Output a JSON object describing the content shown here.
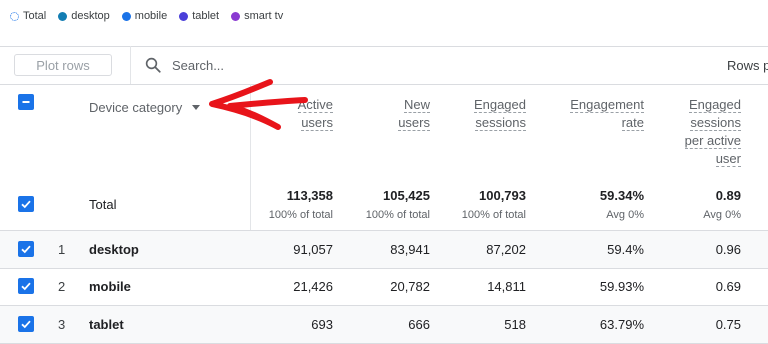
{
  "legend": [
    {
      "label": "Total",
      "color": "#1a73e8",
      "style": "dotted"
    },
    {
      "label": "desktop",
      "color": "#137db3"
    },
    {
      "label": "mobile",
      "color": "#1a73e8"
    },
    {
      "label": "tablet",
      "color": "#4a3fd9"
    },
    {
      "label": "smart tv",
      "color": "#8a3ad1"
    }
  ],
  "toolbar": {
    "plot_rows_label": "Plot rows",
    "search_placeholder": "Search...",
    "rows_label": "Rows p"
  },
  "table": {
    "dimension_header": "Device category",
    "columns": [
      {
        "lines": [
          "Active",
          "users"
        ]
      },
      {
        "lines": [
          "New",
          "users"
        ]
      },
      {
        "lines": [
          "Engaged",
          "sessions"
        ]
      },
      {
        "lines": [
          "Engagement",
          "rate"
        ]
      },
      {
        "lines": [
          "Engaged",
          "sessions",
          "per active",
          "user"
        ]
      }
    ],
    "total": {
      "label": "Total",
      "values": [
        "113,358",
        "105,425",
        "100,793",
        "59.34%",
        "0.89"
      ],
      "subs": [
        "100% of total",
        "100% of total",
        "100% of total",
        "Avg 0%",
        "Avg 0%"
      ]
    },
    "rows": [
      {
        "rank": "1",
        "name": "desktop",
        "values": [
          "91,057",
          "83,941",
          "87,202",
          "59.4%",
          "0.96"
        ]
      },
      {
        "rank": "2",
        "name": "mobile",
        "values": [
          "21,426",
          "20,782",
          "14,811",
          "59.93%",
          "0.69"
        ]
      },
      {
        "rank": "3",
        "name": "tablet",
        "values": [
          "693",
          "666",
          "518",
          "63.79%",
          "0.75"
        ]
      }
    ]
  },
  "annotation": {
    "color": "#e8141a",
    "icon": "red-hand-drawn-arrow"
  }
}
